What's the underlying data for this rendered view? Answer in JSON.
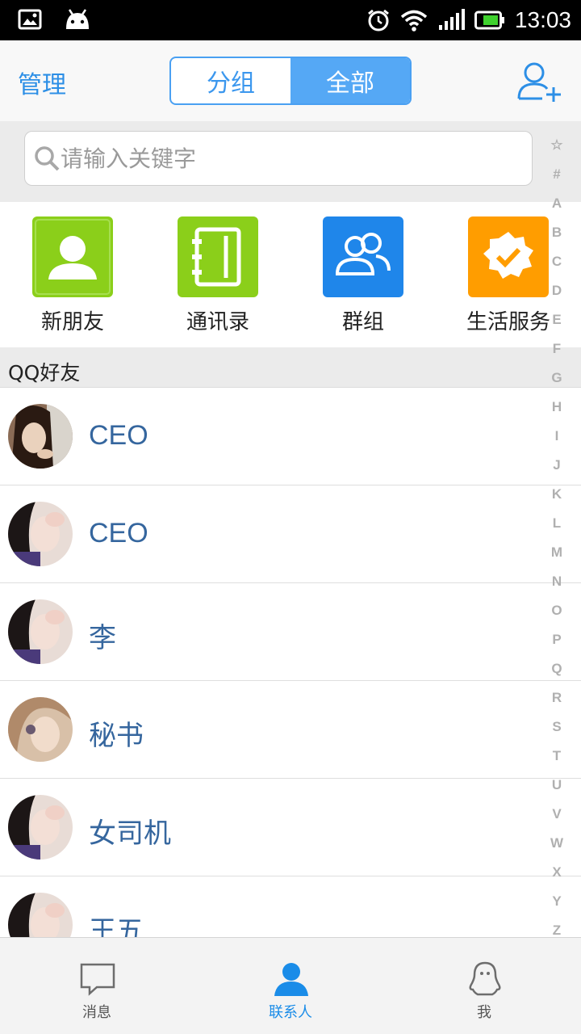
{
  "status_bar": {
    "time": "13:03"
  },
  "header": {
    "manage_label": "管理",
    "segments": [
      {
        "label": "分组",
        "active": false
      },
      {
        "label": "全部",
        "active": true
      }
    ]
  },
  "search": {
    "placeholder": "请输入关键字"
  },
  "quick_entries": [
    {
      "label": "新朋友",
      "icon": "new-friend-icon",
      "color": "#8bcf1a"
    },
    {
      "label": "通讯录",
      "icon": "address-book-icon",
      "color": "#8bcf1a"
    },
    {
      "label": "群组",
      "icon": "group-icon",
      "color": "#1f86ea"
    },
    {
      "label": "生活服务",
      "icon": "life-service-icon",
      "color": "#ff9d00"
    }
  ],
  "section": {
    "title": "QQ好友"
  },
  "contacts": [
    {
      "name": "CEO"
    },
    {
      "name": "CEO"
    },
    {
      "name": "李"
    },
    {
      "name": "秘书"
    },
    {
      "name": "女司机"
    },
    {
      "name": "王五"
    }
  ],
  "index_letters": [
    "☆",
    "#",
    "A",
    "B",
    "C",
    "D",
    "E",
    "F",
    "G",
    "H",
    "I",
    "J",
    "K",
    "L",
    "M",
    "N",
    "O",
    "P",
    "Q",
    "R",
    "S",
    "T",
    "U",
    "V",
    "W",
    "X",
    "Y",
    "Z"
  ],
  "tabs": [
    {
      "label": "消息",
      "icon": "message-icon",
      "active": false
    },
    {
      "label": "联系人",
      "icon": "contacts-icon",
      "active": true
    },
    {
      "label": "我",
      "icon": "qq-penguin-icon",
      "active": false
    }
  ],
  "colors": {
    "accent": "#2d8fe6",
    "contact_name": "#35669e",
    "tab_active": "#1a8ce8"
  }
}
